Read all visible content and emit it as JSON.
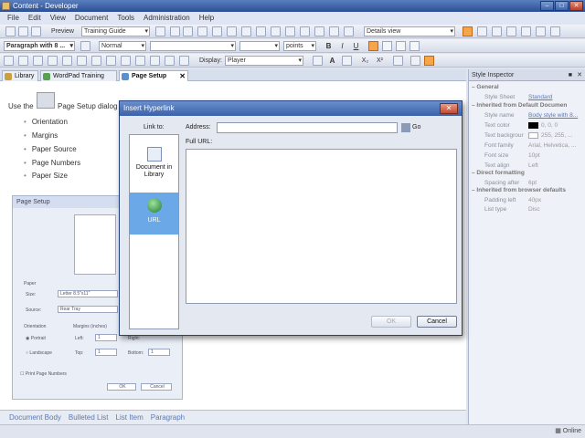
{
  "window": {
    "title": "Content - Developer"
  },
  "menu": [
    "File",
    "Edit",
    "View",
    "Document",
    "Tools",
    "Administration",
    "Help"
  ],
  "toolbar1": {
    "preview_label": "Preview",
    "preview_value": "Training Guide",
    "view_value": "Details view"
  },
  "toolbar2": {
    "style_value": "Paragraph with 8 ...",
    "normal_value": "Normal",
    "points_value": "points",
    "bold": "B",
    "italic": "I",
    "underline": "U"
  },
  "toolbar3": {
    "display_label": "Display:",
    "display_value": "Player",
    "font_a": "A",
    "sub": "X₂",
    "sup": "X²"
  },
  "tabs": [
    {
      "label": "Library",
      "icon_color": "#c8a040"
    },
    {
      "label": "WordPad Training",
      "icon_color": "#5aa050"
    },
    {
      "label": "Page Setup",
      "icon_color": "#5a90d0"
    }
  ],
  "document": {
    "intro_before": "Use the",
    "intro_after": "Page Setup dialog",
    "bullets": [
      "Orientation",
      "Margins",
      "Paper Source",
      "Page Numbers",
      "Paper Size"
    ],
    "setup": {
      "title": "Page Setup",
      "paper_label": "Paper",
      "size_label": "Size:",
      "size_value": "Letter 8.5\"x11\"",
      "source_label": "Source:",
      "source_value": "Rear Tray",
      "orientation_label": "Orientation",
      "portrait": "Portrait",
      "landscape": "Landscape",
      "margins_label": "Margins (inches)",
      "left_label": "Left:",
      "left_value": "1",
      "right_label": "Right:",
      "top_label": "Top:",
      "top_value": "1",
      "bottom_label": "Bottom:",
      "bottom_value": "1",
      "print_numbers": "Print Page Numbers",
      "ok": "OK",
      "cancel": "Cancel"
    }
  },
  "status_links": [
    "Document Body",
    "Bulleted List",
    "List Item",
    "Paragraph"
  ],
  "inspector": {
    "title": "Style Inspector",
    "general": "General",
    "style_sheet_key": "Style Sheet",
    "style_sheet_value": "Standard",
    "inherited_default": "Inherited from Default Documen",
    "style_name_key": "Style name",
    "style_name_value": "Body style with 8...",
    "text_color_key": "Text color",
    "text_color_value": "0, 0, 0",
    "text_bg_key": "Text backgrour",
    "text_bg_value": "255, 255, ...",
    "font_family_key": "Font family",
    "font_family_value": "Arial, Helvetica, ...",
    "font_size_key": "Font size",
    "font_size_value": "10pt",
    "text_align_key": "Text align",
    "text_align_value": "Left",
    "direct": "Direct formatting",
    "spacing_key": "Spacing after",
    "spacing_value": "6pt",
    "inherited_browser": "Inherited from browser defaults",
    "padding_key": "Padding left",
    "padding_value": "40px",
    "list_type_key": "List type",
    "list_type_value": "Disc"
  },
  "dialog": {
    "title": "Insert Hyperlink",
    "link_to": "Link to:",
    "address_label": "Address:",
    "address_value": "",
    "go_label": "Go",
    "full_url_label": "Full URL:",
    "items": [
      {
        "label": "Document in Library"
      },
      {
        "label": "URL"
      }
    ],
    "ok": "OK",
    "cancel": "Cancel"
  },
  "statusbar": {
    "online": "Online"
  }
}
